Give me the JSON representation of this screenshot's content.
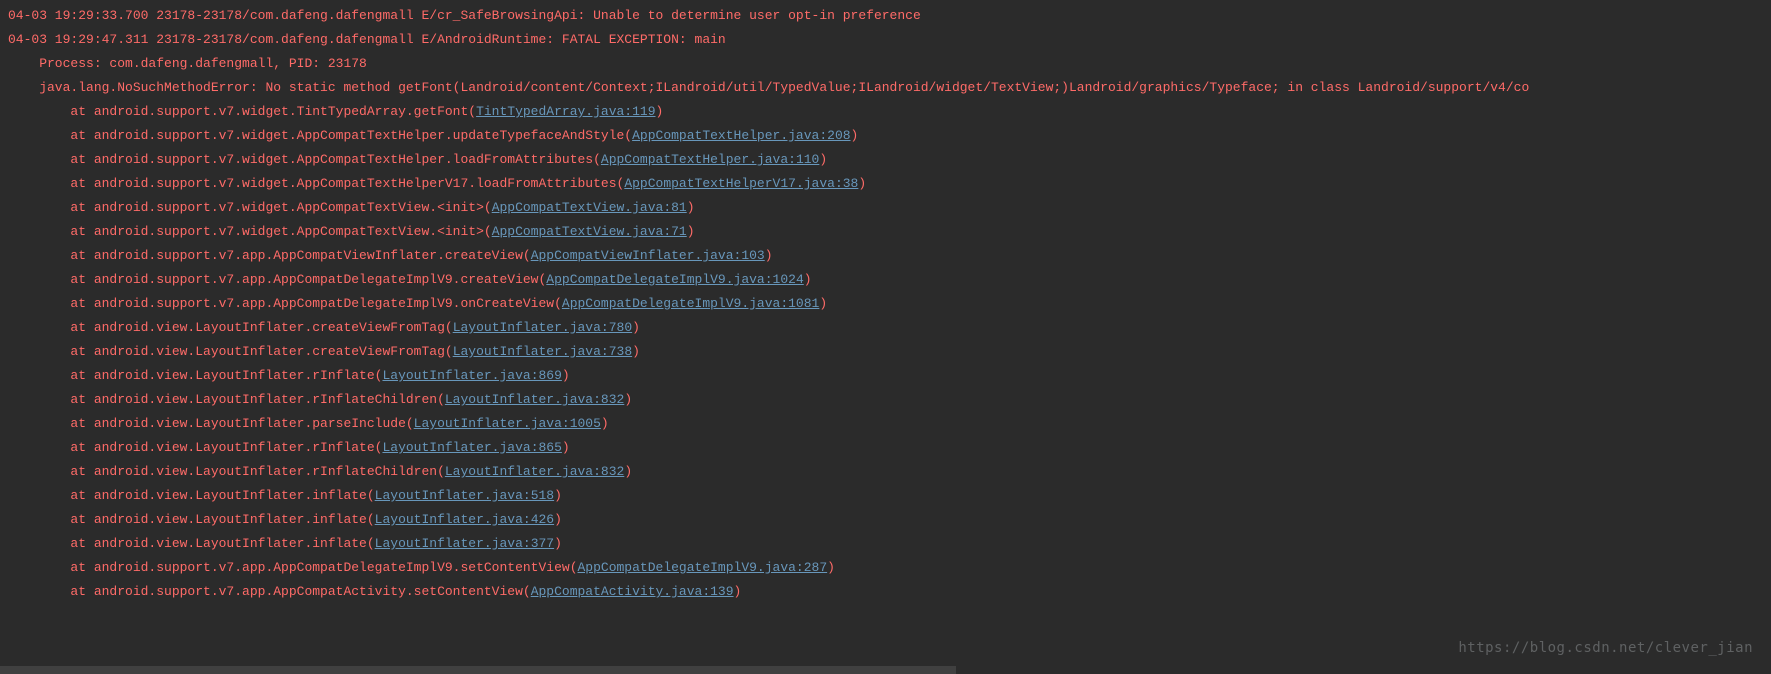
{
  "log": {
    "indent_at": "        at ",
    "indent_ex": "    ",
    "lines": [
      {
        "kind": "plain",
        "text": "04-03 19:29:33.700 23178-23178/com.dafeng.dafengmall E/cr_SafeBrowsingApi: Unable to determine user opt-in preference"
      },
      {
        "kind": "plain",
        "text": "04-03 19:29:47.311 23178-23178/com.dafeng.dafengmall E/AndroidRuntime: FATAL EXCEPTION: main"
      },
      {
        "kind": "indent1",
        "text": "Process: com.dafeng.dafengmall, PID: 23178"
      },
      {
        "kind": "indent1",
        "text": "java.lang.NoSuchMethodError: No static method getFont(Landroid/content/Context;ILandroid/util/TypedValue;ILandroid/widget/TextView;)Landroid/graphics/Typeface; in class Landroid/support/v4/co"
      },
      {
        "kind": "frame",
        "prefix": "android.support.v7.widget.TintTypedArray.getFont",
        "link": "TintTypedArray.java:119"
      },
      {
        "kind": "frame",
        "prefix": "android.support.v7.widget.AppCompatTextHelper.updateTypefaceAndStyle",
        "link": "AppCompatTextHelper.java:208"
      },
      {
        "kind": "frame",
        "prefix": "android.support.v7.widget.AppCompatTextHelper.loadFromAttributes",
        "link": "AppCompatTextHelper.java:110"
      },
      {
        "kind": "frame",
        "prefix": "android.support.v7.widget.AppCompatTextHelperV17.loadFromAttributes",
        "link": "AppCompatTextHelperV17.java:38"
      },
      {
        "kind": "frame",
        "prefix": "android.support.v7.widget.AppCompatTextView.<init>",
        "link": "AppCompatTextView.java:81"
      },
      {
        "kind": "frame",
        "prefix": "android.support.v7.widget.AppCompatTextView.<init>",
        "link": "AppCompatTextView.java:71"
      },
      {
        "kind": "frame",
        "prefix": "android.support.v7.app.AppCompatViewInflater.createView",
        "link": "AppCompatViewInflater.java:103"
      },
      {
        "kind": "frame",
        "prefix": "android.support.v7.app.AppCompatDelegateImplV9.createView",
        "link": "AppCompatDelegateImplV9.java:1024"
      },
      {
        "kind": "frame",
        "prefix": "android.support.v7.app.AppCompatDelegateImplV9.onCreateView",
        "link": "AppCompatDelegateImplV9.java:1081"
      },
      {
        "kind": "frame",
        "prefix": "android.view.LayoutInflater.createViewFromTag",
        "link": "LayoutInflater.java:780"
      },
      {
        "kind": "frame",
        "prefix": "android.view.LayoutInflater.createViewFromTag",
        "link": "LayoutInflater.java:738"
      },
      {
        "kind": "frame",
        "prefix": "android.view.LayoutInflater.rInflate",
        "link": "LayoutInflater.java:869"
      },
      {
        "kind": "frame",
        "prefix": "android.view.LayoutInflater.rInflateChildren",
        "link": "LayoutInflater.java:832"
      },
      {
        "kind": "frame",
        "prefix": "android.view.LayoutInflater.parseInclude",
        "link": "LayoutInflater.java:1005"
      },
      {
        "kind": "frame",
        "prefix": "android.view.LayoutInflater.rInflate",
        "link": "LayoutInflater.java:865"
      },
      {
        "kind": "frame",
        "prefix": "android.view.LayoutInflater.rInflateChildren",
        "link": "LayoutInflater.java:832"
      },
      {
        "kind": "frame",
        "prefix": "android.view.LayoutInflater.inflate",
        "link": "LayoutInflater.java:518"
      },
      {
        "kind": "frame",
        "prefix": "android.view.LayoutInflater.inflate",
        "link": "LayoutInflater.java:426"
      },
      {
        "kind": "frame",
        "prefix": "android.view.LayoutInflater.inflate",
        "link": "LayoutInflater.java:377"
      },
      {
        "kind": "frame",
        "prefix": "android.support.v7.app.AppCompatDelegateImplV9.setContentView",
        "link": "AppCompatDelegateImplV9.java:287"
      },
      {
        "kind": "frame",
        "prefix": "android.support.v7.app.AppCompatActivity.setContentView",
        "link": "AppCompatActivity.java:139"
      }
    ]
  },
  "watermark": "https://blog.csdn.net/clever_jian"
}
